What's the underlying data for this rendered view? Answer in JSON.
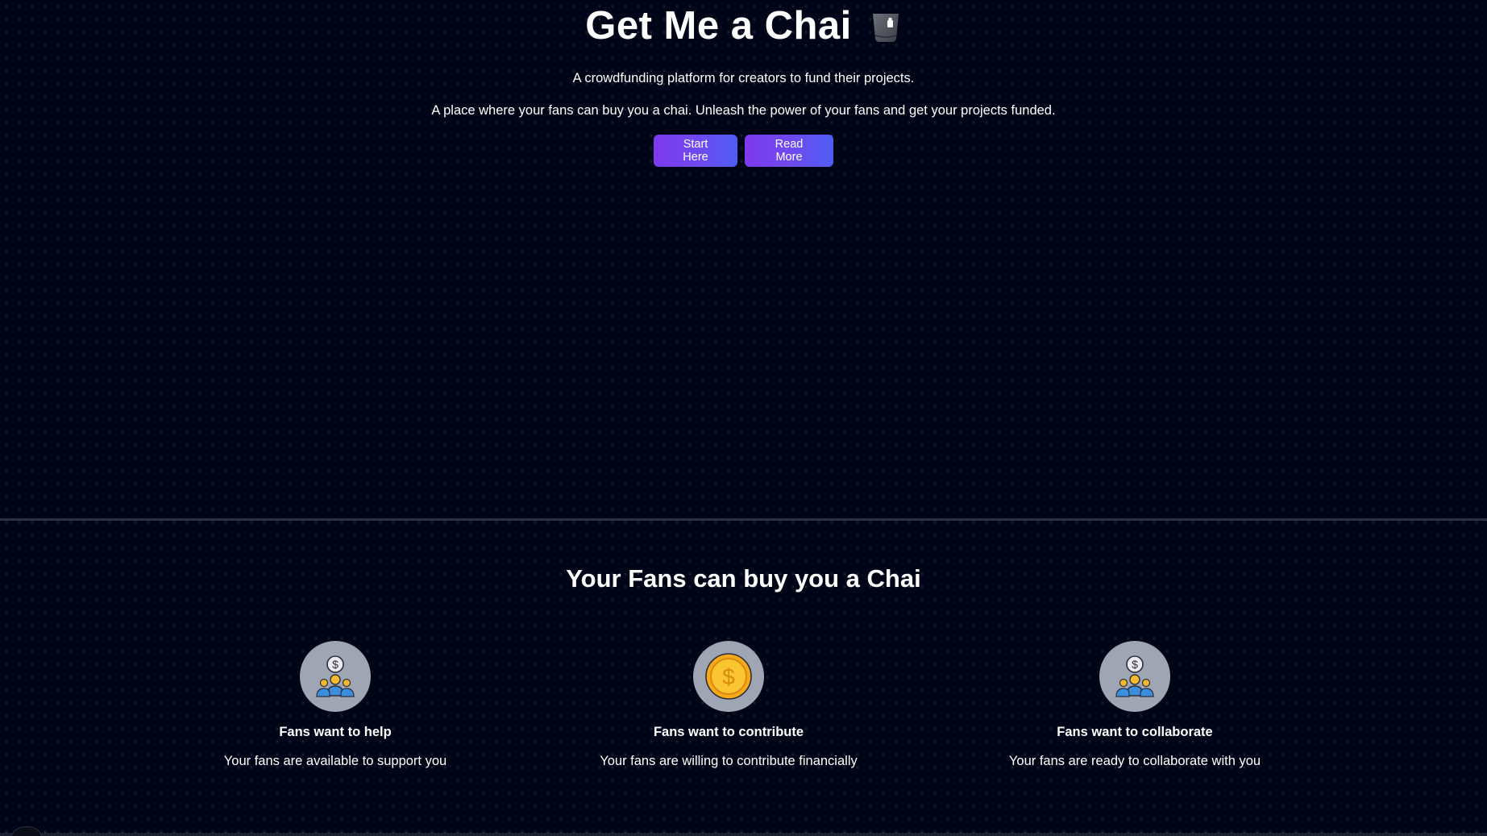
{
  "hero": {
    "title": "Get Me a Chai",
    "subtitle": "A crowdfunding platform for creators to fund their projects.",
    "tagline": "A place where your fans can buy you a chai. Unleash the power of your fans and get your projects funded.",
    "buttons": {
      "start_label": "Start Here",
      "read_label": "Read More"
    },
    "icon": "tea-cup-icon"
  },
  "fans_section": {
    "title": "Your Fans can buy you a Chai",
    "features": [
      {
        "icon": "fans-money-icon",
        "title": "Fans want to help",
        "description": "Your fans are available to support you"
      },
      {
        "icon": "gold-coin-icon",
        "title": "Fans want to contribute",
        "description": "Your fans are willing to contribute financially"
      },
      {
        "icon": "fans-money-icon",
        "title": "Fans want to collaborate",
        "description": "Your fans are ready to collaborate with you"
      }
    ]
  },
  "colors": {
    "background": "#000617",
    "button_gradient_start": "#7c3aed",
    "button_gradient_end": "#4f5ef5",
    "icon_circle": "#a0a5b4"
  }
}
